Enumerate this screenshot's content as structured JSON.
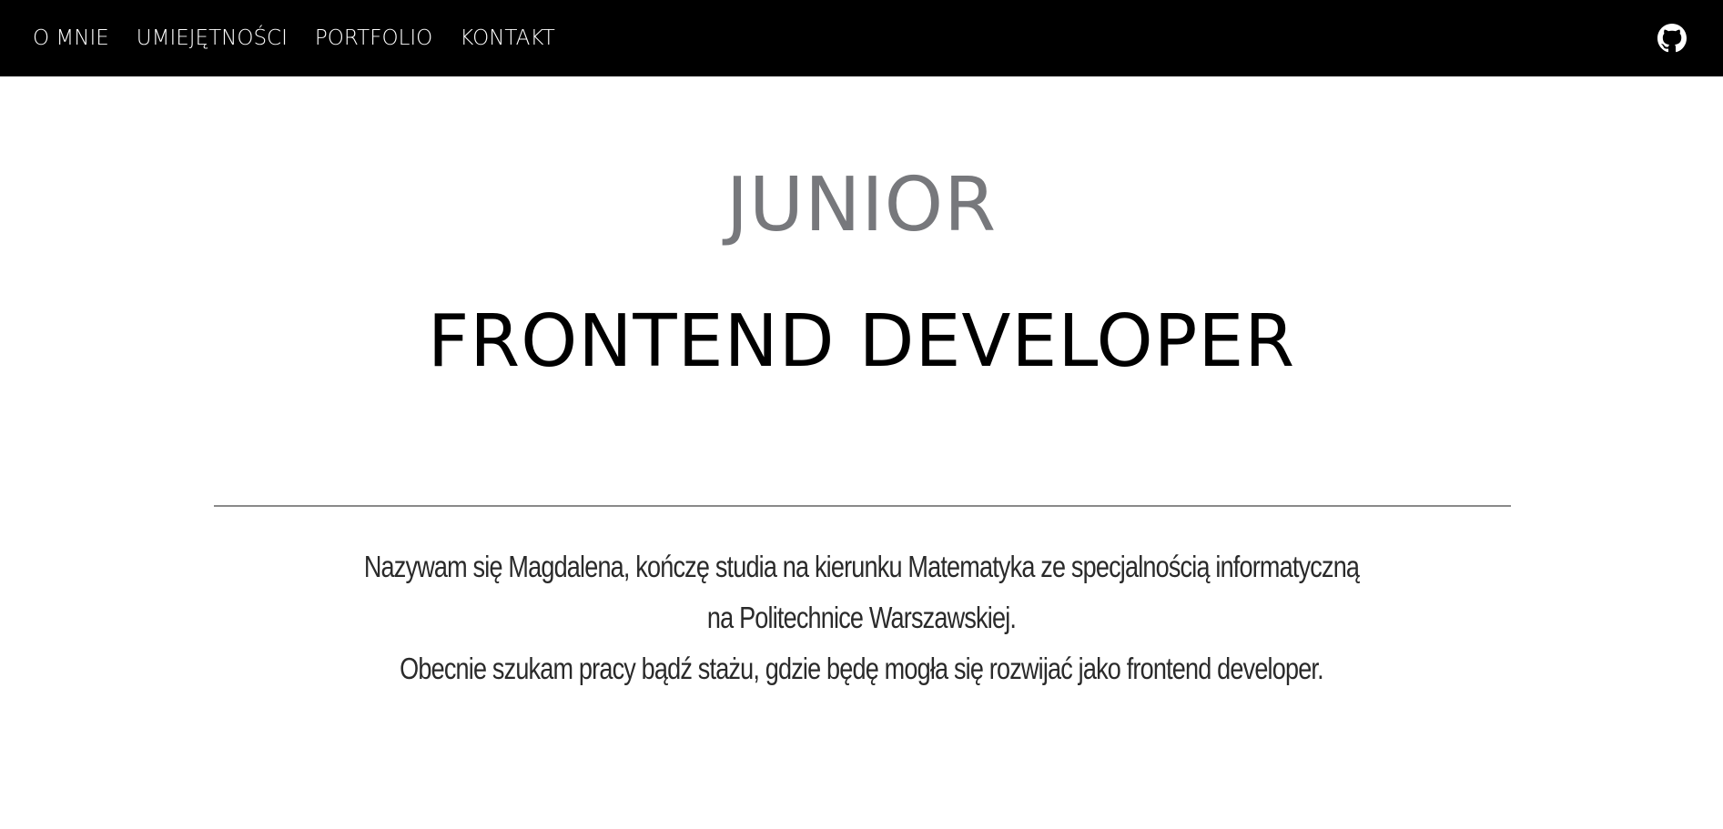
{
  "nav": {
    "items": [
      {
        "label": "O MNIE"
      },
      {
        "label": "UMIEJĘTNOŚCI"
      },
      {
        "label": "PORTFOLIO"
      },
      {
        "label": "KONTAKT"
      }
    ],
    "github_icon": "github-icon"
  },
  "hero": {
    "junior": "JUNIOR",
    "title": "FRONTEND DEVELOPER"
  },
  "intro": {
    "line1": "Nazywam się Magdalena, kończę studia na kierunku Matematyka ze specjalnością informatyczną",
    "line2": "na Politechnice Warszawskiej.",
    "line3": "Obecnie szukam pracy bądź stażu, gdzie będę mogła się rozwijać jako frontend developer."
  },
  "colors": {
    "topbar": "#000000",
    "nav_text": "#ffffff",
    "junior_text": "#77787c",
    "title_text": "#000000",
    "intro_text": "#2a2a2a",
    "divider": "#8a8a8a"
  }
}
